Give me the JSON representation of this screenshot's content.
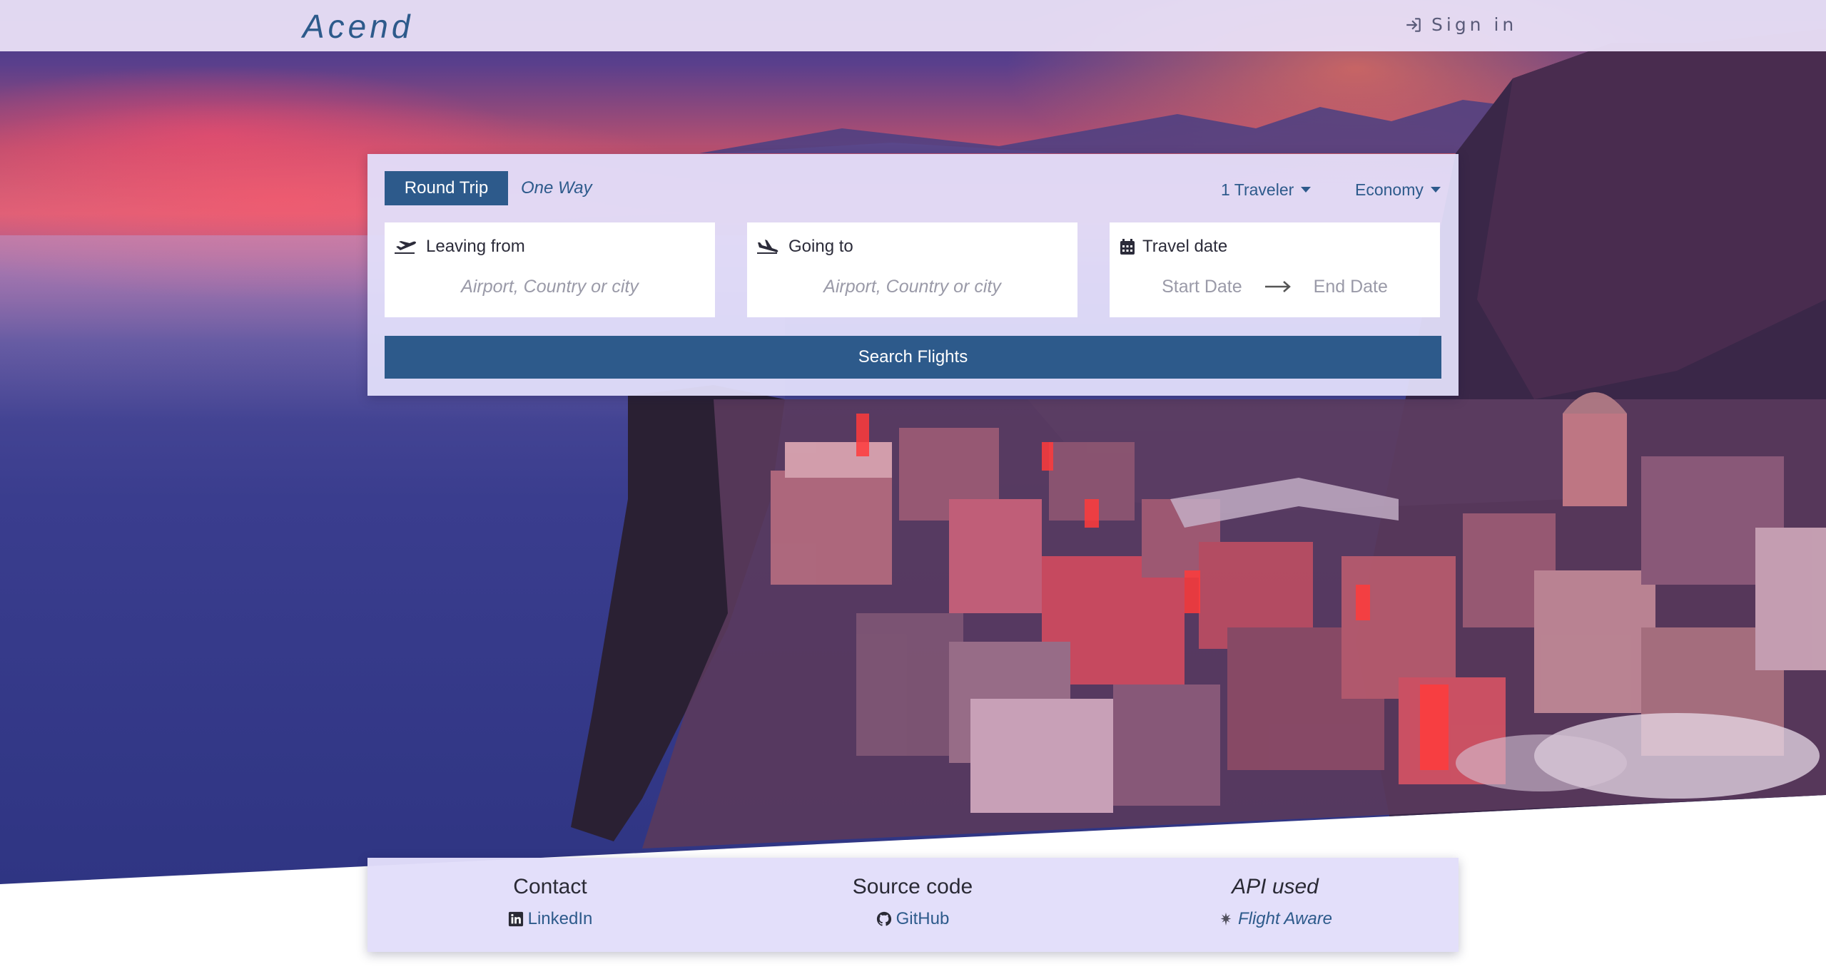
{
  "navbar": {
    "brand": "Acend",
    "signin_label": "Sign in"
  },
  "search": {
    "trip_types": {
      "round_trip": "Round Trip",
      "one_way": "One Way"
    },
    "selected_trip_type": "Round Trip",
    "travelers_label": "1 Traveler",
    "cabin_class_label": "Economy",
    "leaving_from": {
      "label": "Leaving from",
      "placeholder": "Airport, Country or city"
    },
    "going_to": {
      "label": "Going to",
      "placeholder": "Airport, Country or city"
    },
    "travel_date": {
      "label": "Travel date",
      "start_placeholder": "Start Date",
      "end_placeholder": "End Date"
    },
    "submit_label": "Search Flights"
  },
  "footer": {
    "contact": {
      "title": "Contact",
      "link": "LinkedIn",
      "icon": "linkedin-icon"
    },
    "source": {
      "title": "Source code",
      "link": "GitHub",
      "icon": "github-icon"
    },
    "api": {
      "title": "API used",
      "link": "Flight Aware",
      "icon": "flightaware-icon"
    }
  },
  "colors": {
    "primary": "#2d5a8b",
    "navbar_bg": "#e8dff6",
    "card_bg": "#e2defa"
  }
}
